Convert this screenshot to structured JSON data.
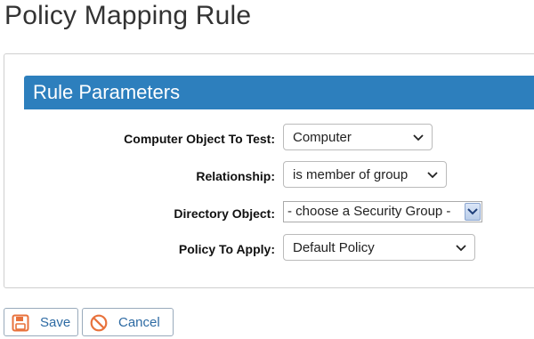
{
  "page": {
    "title": "Policy Mapping Rule"
  },
  "section": {
    "title": "Rule Parameters"
  },
  "fields": {
    "computer_object": {
      "label": "Computer Object To Test:",
      "value": "Computer"
    },
    "relationship": {
      "label": "Relationship:",
      "value": "is member of group"
    },
    "directory_object": {
      "label": "Directory Object:",
      "value": "- choose a Security Group -"
    },
    "policy": {
      "label": "Policy To Apply:",
      "value": "Default Policy"
    }
  },
  "actions": {
    "save_label": "Save",
    "cancel_label": "Cancel"
  },
  "colors": {
    "header_bg": "#2d7fbd",
    "accent": "#e8723c",
    "link": "#2d6aa3"
  },
  "icons": {
    "save": "floppy-disk-icon",
    "cancel": "prohibited-icon",
    "dropdown": "chevron-down-icon"
  }
}
